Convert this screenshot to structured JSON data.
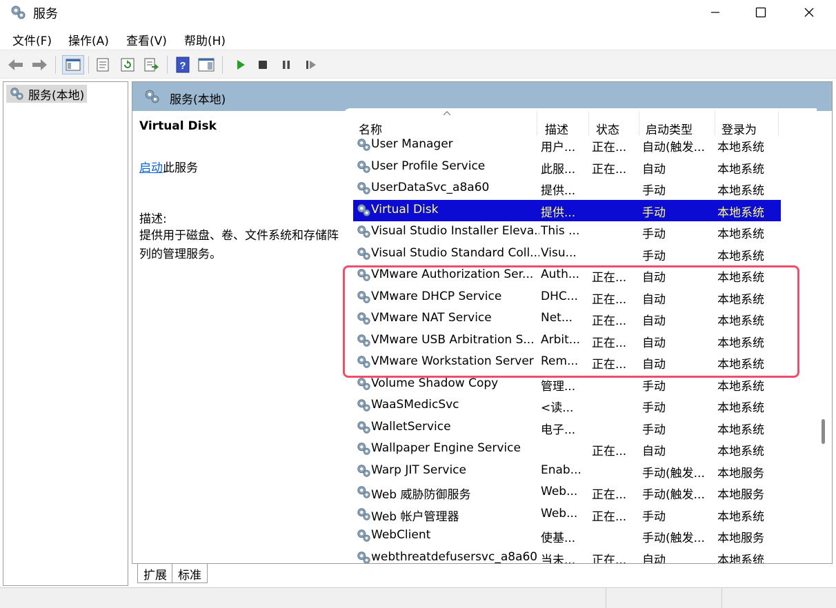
{
  "window": {
    "title": "服务"
  },
  "menu": [
    "文件(F)",
    "操作(A)",
    "查看(V)",
    "帮助(H)"
  ],
  "toolbar": {
    "icons": [
      "back-icon",
      "forward-icon",
      "show-tree-icon",
      "properties-icon",
      "refresh-icon",
      "export-icon",
      "help-icon",
      "console-icon",
      "start-icon",
      "stop-icon",
      "pause-icon",
      "restart-icon"
    ]
  },
  "tree": {
    "root": "服务(本地)"
  },
  "pane": {
    "header": "服务(本地)",
    "selected_name": "Virtual Disk",
    "action_link": "启动",
    "action_suffix": "此服务",
    "desc_label": "描述:",
    "desc_text": "提供用于磁盘、卷、文件系统和存储阵列的管理服务。"
  },
  "columns": [
    "名称",
    "描述",
    "状态",
    "启动类型",
    "登录为"
  ],
  "rows": [
    {
      "name": "User Manager",
      "desc": "用户...",
      "status": "正在...",
      "start": "自动(触发...",
      "logon": "本地系统"
    },
    {
      "name": "User Profile Service",
      "desc": "此服...",
      "status": "正在...",
      "start": "自动",
      "logon": "本地系统"
    },
    {
      "name": "UserDataSvc_a8a60",
      "desc": "提供...",
      "status": "",
      "start": "手动",
      "logon": "本地系统"
    },
    {
      "name": "Virtual Disk",
      "desc": "提供...",
      "status": "",
      "start": "手动",
      "logon": "本地系统",
      "selected": true
    },
    {
      "name": "Visual Studio Installer Eleva...",
      "desc": "This ...",
      "status": "",
      "start": "手动",
      "logon": "本地系统"
    },
    {
      "name": "Visual Studio Standard Coll...",
      "desc": "Visu...",
      "status": "",
      "start": "手动",
      "logon": "本地系统"
    },
    {
      "name": "VMware Authorization Ser...",
      "desc": "Auth...",
      "status": "正在...",
      "start": "自动",
      "logon": "本地系统"
    },
    {
      "name": "VMware DHCP Service",
      "desc": "DHC...",
      "status": "正在...",
      "start": "自动",
      "logon": "本地系统"
    },
    {
      "name": "VMware NAT Service",
      "desc": "Net...",
      "status": "正在...",
      "start": "自动",
      "logon": "本地系统"
    },
    {
      "name": "VMware USB Arbitration S...",
      "desc": "Arbit...",
      "status": "正在...",
      "start": "自动",
      "logon": "本地系统"
    },
    {
      "name": "VMware Workstation Server",
      "desc": "Rem...",
      "status": "正在...",
      "start": "自动",
      "logon": "本地系统"
    },
    {
      "name": "Volume Shadow Copy",
      "desc": "管理...",
      "status": "",
      "start": "手动",
      "logon": "本地系统"
    },
    {
      "name": "WaaSMedicSvc",
      "desc": "<读...",
      "status": "",
      "start": "手动",
      "logon": "本地系统"
    },
    {
      "name": "WalletService",
      "desc": "电子...",
      "status": "",
      "start": "手动",
      "logon": "本地系统"
    },
    {
      "name": "Wallpaper Engine Service",
      "desc": "",
      "status": "正在...",
      "start": "自动",
      "logon": "本地系统"
    },
    {
      "name": "Warp JIT Service",
      "desc": "Enab...",
      "status": "",
      "start": "手动(触发...",
      "logon": "本地服务"
    },
    {
      "name": "Web 威胁防御服务",
      "desc": "Web...",
      "status": "正在...",
      "start": "手动(触发...",
      "logon": "本地服务"
    },
    {
      "name": "Web 帐户管理器",
      "desc": "Web...",
      "status": "正在...",
      "start": "手动",
      "logon": "本地系统"
    },
    {
      "name": "WebClient",
      "desc": "使基...",
      "status": "",
      "start": "手动(触发...",
      "logon": "本地服务"
    },
    {
      "name": "webthreatdefusersvc_a8a60",
      "desc": "当未...",
      "status": "正在...",
      "start": "自动",
      "logon": "本地系统"
    }
  ],
  "tabs": [
    "扩展",
    "标准"
  ],
  "colors": {
    "selection_bg": "#0b0bd4",
    "selection_fg": "#ffff7a",
    "highlight_border": "#ee4e6a",
    "header_bg": "#9db9d2"
  }
}
